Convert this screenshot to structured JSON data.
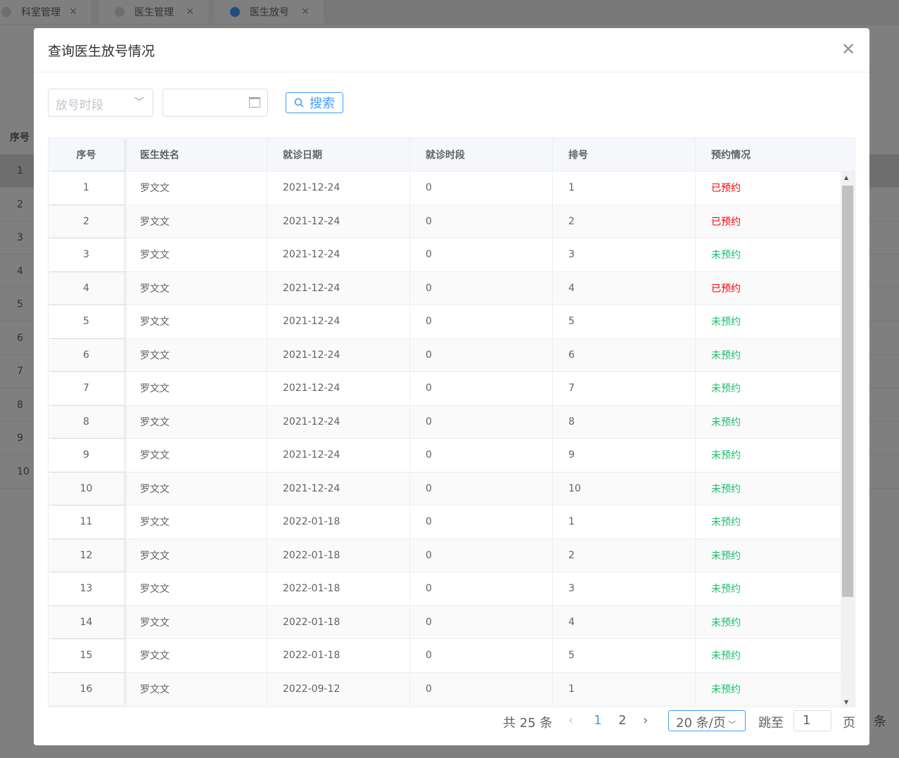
{
  "tabs": [
    {
      "label": "科室管理"
    },
    {
      "label": "医生管理"
    },
    {
      "label": "医生放号"
    }
  ],
  "background": {
    "header": "序号",
    "rows": [
      "1",
      "2",
      "3",
      "4",
      "5",
      "6",
      "7",
      "8",
      "9",
      "10"
    ],
    "footer_text": "条"
  },
  "modal": {
    "title": "查询医生放号情况",
    "select_placeholder": "放号时段",
    "date_value": "",
    "search_label": "搜索"
  },
  "table": {
    "columns": [
      "序号",
      "医生姓名",
      "就诊日期",
      "就诊时段",
      "排号",
      "预约情况"
    ],
    "rows": [
      [
        "1",
        "罗文文",
        "2021-12-24",
        "0",
        "1",
        "已预约"
      ],
      [
        "2",
        "罗文文",
        "2021-12-24",
        "0",
        "2",
        "已预约"
      ],
      [
        "3",
        "罗文文",
        "2021-12-24",
        "0",
        "3",
        "未预约"
      ],
      [
        "4",
        "罗文文",
        "2021-12-24",
        "0",
        "4",
        "已预约"
      ],
      [
        "5",
        "罗文文",
        "2021-12-24",
        "0",
        "5",
        "未预约"
      ],
      [
        "6",
        "罗文文",
        "2021-12-24",
        "0",
        "6",
        "未预约"
      ],
      [
        "7",
        "罗文文",
        "2021-12-24",
        "0",
        "7",
        "未预约"
      ],
      [
        "8",
        "罗文文",
        "2021-12-24",
        "0",
        "8",
        "未预约"
      ],
      [
        "9",
        "罗文文",
        "2021-12-24",
        "0",
        "9",
        "未预约"
      ],
      [
        "10",
        "罗文文",
        "2021-12-24",
        "0",
        "10",
        "未预约"
      ],
      [
        "11",
        "罗文文",
        "2022-01-18",
        "0",
        "1",
        "未预约"
      ],
      [
        "12",
        "罗文文",
        "2022-01-18",
        "0",
        "2",
        "未预约"
      ],
      [
        "13",
        "罗文文",
        "2022-01-18",
        "0",
        "3",
        "未预约"
      ],
      [
        "14",
        "罗文文",
        "2022-01-18",
        "0",
        "4",
        "未预约"
      ],
      [
        "15",
        "罗文文",
        "2022-01-18",
        "0",
        "5",
        "未预约"
      ],
      [
        "16",
        "罗文文",
        "2022-09-12",
        "0",
        "1",
        "未预约"
      ]
    ]
  },
  "pagination": {
    "total": "共 25 条",
    "pages": [
      "1",
      "2"
    ],
    "current": "1",
    "page_size": "20 条/页",
    "jump_label": "跳至",
    "jump_value": "1",
    "page_unit": "页"
  },
  "colors": {
    "booked": "#ff0000",
    "free": "#19be6b",
    "accent": "#409eff"
  }
}
